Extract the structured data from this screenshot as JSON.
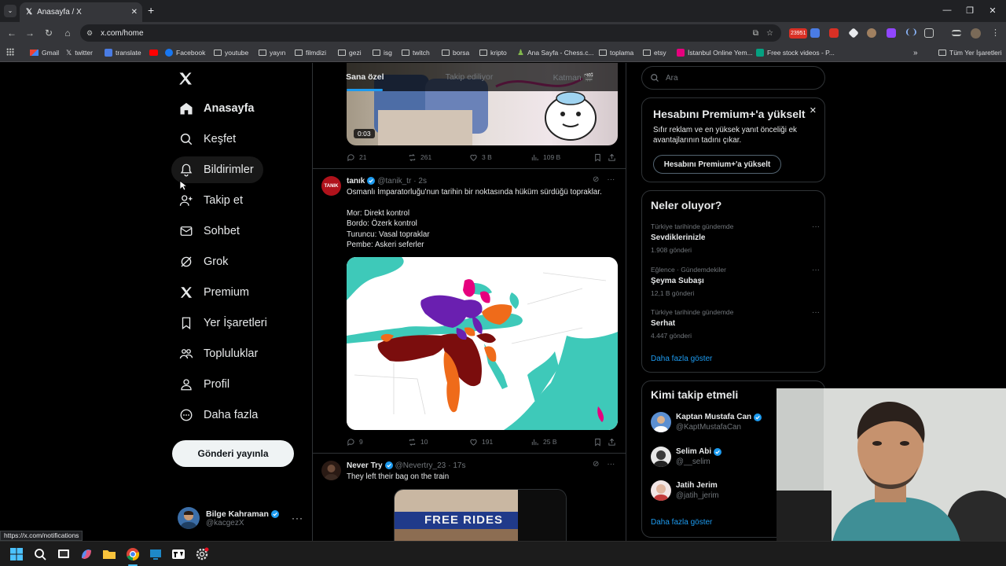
{
  "browser": {
    "tab_title": "Anasayfa / X",
    "url": "x.com/home",
    "ext_badge": "23951",
    "bookmarks": [
      {
        "label": "Gmail",
        "icon": "gmail-icon"
      },
      {
        "label": "twitter",
        "icon": "x-icon"
      },
      {
        "label": "translate",
        "icon": "translate-icon"
      },
      {
        "label": "",
        "icon": "youtube-icon"
      },
      {
        "label": "Facebook",
        "icon": "facebook-icon"
      },
      {
        "label": "youtube",
        "icon": "folder-icon"
      },
      {
        "label": "yayın",
        "icon": "folder-icon"
      },
      {
        "label": "filmdizi",
        "icon": "folder-icon"
      },
      {
        "label": "gezi",
        "icon": "folder-icon"
      },
      {
        "label": "isg",
        "icon": "folder-icon"
      },
      {
        "label": "twitch",
        "icon": "folder-icon"
      },
      {
        "label": "borsa",
        "icon": "folder-icon"
      },
      {
        "label": "kripto",
        "icon": "folder-icon"
      },
      {
        "label": "Ana Sayfa - Chess.c...",
        "icon": "chess-icon"
      },
      {
        "label": "toplama",
        "icon": "folder-icon"
      },
      {
        "label": "etsy",
        "icon": "folder-icon"
      },
      {
        "label": "İstanbul Online Yem...",
        "icon": "yemek-icon"
      },
      {
        "label": "Free stock videos - P...",
        "icon": "pexels-icon"
      }
    ],
    "all_bookmarks": "Tüm Yer İşaretleri",
    "status_url": "https://x.com/notifications"
  },
  "sidebar": {
    "items": [
      {
        "label": "Anasayfa",
        "icon": "home-icon"
      },
      {
        "label": "Keşfet",
        "icon": "search-icon"
      },
      {
        "label": "Bildirimler",
        "icon": "bell-icon"
      },
      {
        "label": "Takip et",
        "icon": "add-user-icon"
      },
      {
        "label": "Sohbet",
        "icon": "mail-icon"
      },
      {
        "label": "Grok",
        "icon": "grok-icon"
      },
      {
        "label": "Premium",
        "icon": "x-icon"
      },
      {
        "label": "Yer İşaretleri",
        "icon": "bookmark-icon"
      },
      {
        "label": "Topluluklar",
        "icon": "communities-icon"
      },
      {
        "label": "Profil",
        "icon": "profile-icon"
      },
      {
        "label": "Daha fazla",
        "icon": "more-icon"
      }
    ],
    "post_label": "Gönderi yayınla",
    "account": {
      "name": "Bilge Kahraman",
      "handle": "@kacgezX"
    }
  },
  "timeline": {
    "tabs": [
      "Sana özel",
      "Takip ediliyor",
      "Katman 🎬"
    ],
    "video_tweet": {
      "duration": "0:03",
      "stats": {
        "replies": "21",
        "reposts": "261",
        "likes": "3 B",
        "views": "109 B"
      }
    },
    "map_tweet": {
      "name": "tanık",
      "avatar_text": "TANIK",
      "handle": "@tanik_tr",
      "time": "· 2s",
      "lines": [
        "Osmanlı İmparatorluğu'nun tarihin bir noktasında hüküm sürdüğü topraklar.",
        "",
        "Mor: Direkt kontrol",
        "Bordo: Özerk kontrol",
        "Turuncu: Vasal topraklar",
        "Pembe: Askeri seferler"
      ],
      "stats": {
        "replies": "9",
        "reposts": "10",
        "likes": "191",
        "views": "25 B"
      }
    },
    "photo_tweet": {
      "name": "Never Try",
      "handle": "@Nevertry_23",
      "time": "· 17s",
      "text": "They left their bag on the train",
      "sign": "FREE RIDES"
    }
  },
  "right": {
    "search_placeholder": "Ara",
    "premium": {
      "title": "Hesabını Premium+'a yükselt",
      "desc": "Sıfır reklam ve en yüksek yanıt önceliği ek avantajlarının tadını çıkar.",
      "button": "Hesabını Premium+'a yükselt"
    },
    "trends": {
      "title": "Neler oluyor?",
      "items": [
        {
          "context": "Türkiye tarihinde gündemde",
          "name": "Sevdiklerinizle",
          "count": "1.908 gönderi"
        },
        {
          "context": "Eğlence · Gündemdekiler",
          "name": "Şeyma Subaşı",
          "count": "12,1 B gönderi"
        },
        {
          "context": "Türkiye tarihinde gündemde",
          "name": "Serhat",
          "count": "4.447 gönderi"
        }
      ],
      "show_more": "Daha fazla göster"
    },
    "who_to_follow": {
      "title": "Kimi takip etmeli",
      "users": [
        {
          "name": "Kaptan Mustafa Can",
          "handle": "@KaptMustafaCan",
          "verified": true
        },
        {
          "name": "Selim Abi",
          "handle": "@__selim",
          "verified": true
        },
        {
          "name": "Jatih Jerim",
          "handle": "@jatih_jerim",
          "verified": false
        }
      ],
      "show_more": "Daha fazla göster"
    }
  },
  "colors": {
    "accent": "#1d9bf0",
    "background": "#000000",
    "border": "#2f3336",
    "muted": "#71767b"
  }
}
